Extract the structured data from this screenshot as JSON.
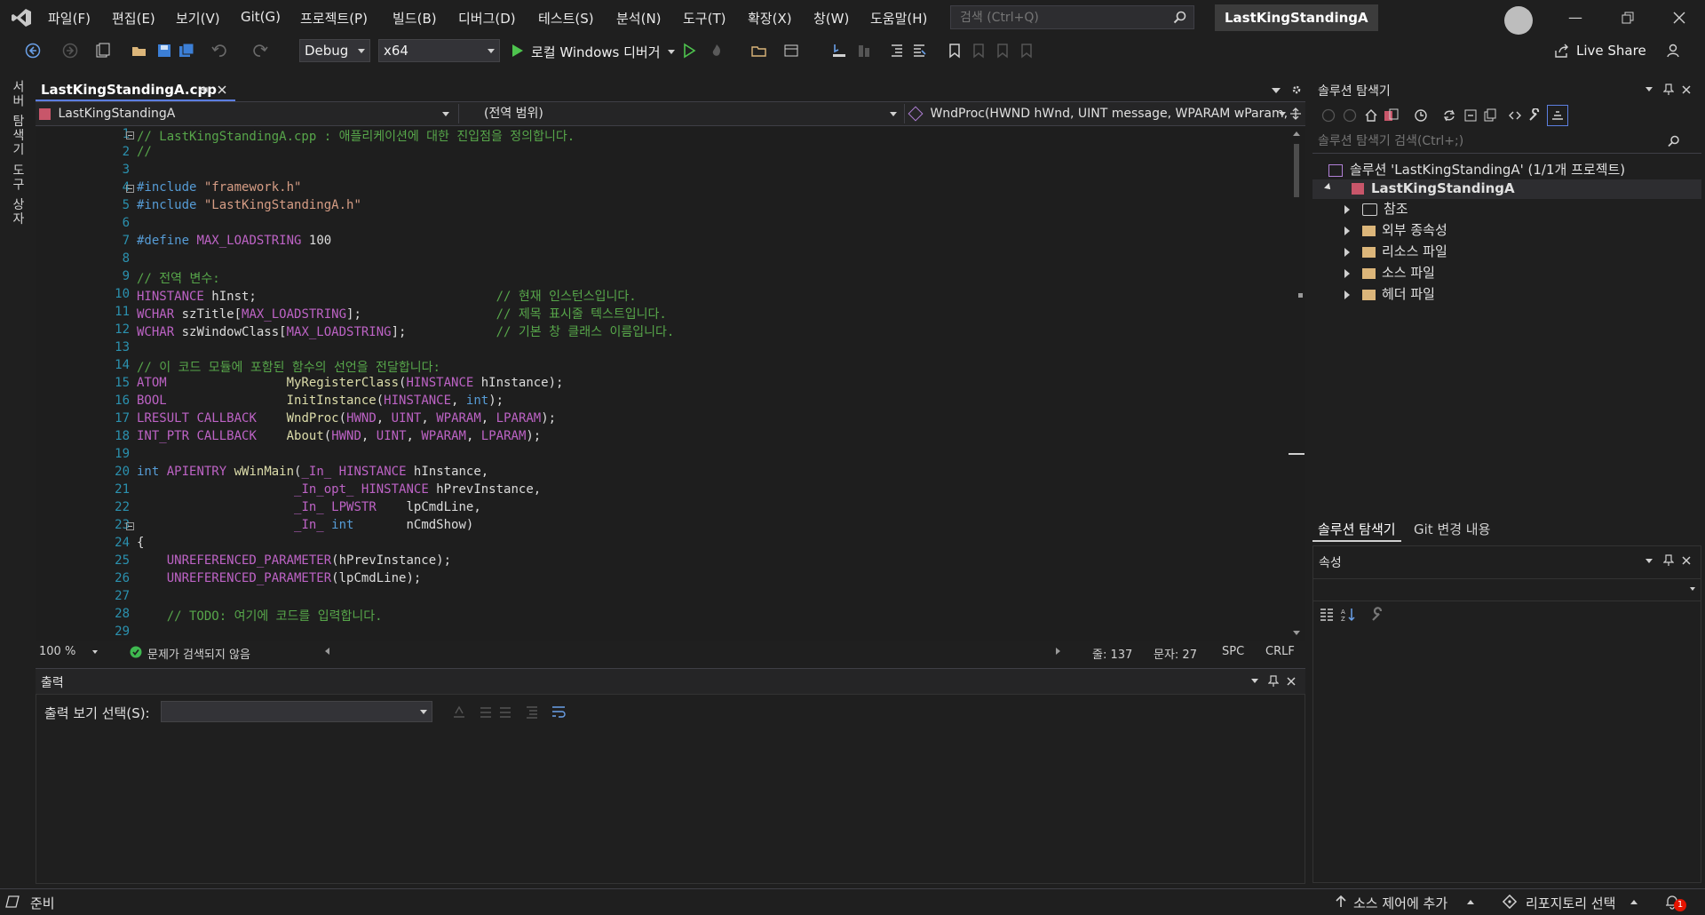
{
  "menu": {
    "items": [
      "파일(F)",
      "편집(E)",
      "보기(V)",
      "Git(G)",
      "프로젝트(P)",
      "빌드(B)",
      "디버그(D)",
      "테스트(S)",
      "분석(N)",
      "도구(T)",
      "확장(X)",
      "창(W)",
      "도움말(H)"
    ],
    "search_placeholder": "검색 (Ctrl+Q)",
    "project_title": "LastKingStandingA"
  },
  "toolbar": {
    "config": "Debug",
    "platform": "x64",
    "run_label": "로컬 Windows 디버거",
    "live_share": "Live Share"
  },
  "left_tabs": [
    "서버 탐색기",
    "도구 상자"
  ],
  "editor": {
    "tab_title": "LastKingStandingA.cpp",
    "nav_project": "LastKingStandingA",
    "nav_scope": "(전역 범위)",
    "nav_member": "WndProc(HWND hWnd, UINT message, WPARAM wParam, LP",
    "line_numbers": [
      "1",
      "2",
      "3",
      "4",
      "5",
      "6",
      "7",
      "8",
      "9",
      "10",
      "11",
      "12",
      "13",
      "14",
      "15",
      "16",
      "17",
      "18",
      "19",
      "20",
      "21",
      "22",
      "23",
      "24",
      "25",
      "26",
      "27",
      "28",
      "29"
    ],
    "lines": [
      {
        "t": "// LastKingStandingA.cpp : 애플리케이션에 대한 진입점을 정의합니다."
      },
      {
        "t": "//"
      },
      {
        "t": ""
      },
      {
        "t": "#include \"framework.h\""
      },
      {
        "t": "#include \"LastKingStandingA.h\""
      },
      {
        "t": ""
      },
      {
        "t": "#define MAX_LOADSTRING 100"
      },
      {
        "t": ""
      },
      {
        "t": "// 전역 변수:"
      },
      {
        "t": "HINSTANCE hInst;                                // 현재 인스턴스입니다."
      },
      {
        "t": "WCHAR szTitle[MAX_LOADSTRING];                  // 제목 표시줄 텍스트입니다."
      },
      {
        "t": "WCHAR szWindowClass[MAX_LOADSTRING];            // 기본 창 클래스 이름입니다."
      },
      {
        "t": ""
      },
      {
        "t": "// 이 코드 모듈에 포함된 함수의 선언을 전달합니다:"
      },
      {
        "t": "ATOM                MyRegisterClass(HINSTANCE hInstance);"
      },
      {
        "t": "BOOL                InitInstance(HINSTANCE, int);"
      },
      {
        "t": "LRESULT CALLBACK    WndProc(HWND, UINT, WPARAM, LPARAM);"
      },
      {
        "t": "INT_PTR CALLBACK    About(HWND, UINT, WPARAM, LPARAM);"
      },
      {
        "t": ""
      },
      {
        "t": "int APIENTRY wWinMain(_In_ HINSTANCE hInstance,"
      },
      {
        "t": "                     _In_opt_ HINSTANCE hPrevInstance,"
      },
      {
        "t": "                     _In_ LPWSTR    lpCmdLine,"
      },
      {
        "t": "                     _In_ int       nCmdShow)"
      },
      {
        "t": "{"
      },
      {
        "t": "    UNREFERENCED_PARAMETER(hPrevInstance);"
      },
      {
        "t": "    UNREFERENCED_PARAMETER(lpCmdLine);"
      },
      {
        "t": ""
      },
      {
        "t": "    // TODO: 여기에 코드를 입력합니다."
      },
      {
        "t": ""
      }
    ],
    "zoom": "100 %",
    "issues": "문제가 검색되지 않음",
    "line_label": "줄: 137",
    "char_label": "문자: 27",
    "spc": "SPC",
    "crlf": "CRLF"
  },
  "output": {
    "title": "출력",
    "source_label": "출력 보기 선택(S):",
    "source_value": ""
  },
  "solution": {
    "title": "솔루션 탐색기",
    "search_placeholder": "솔루션 탐색기 검색(Ctrl+;)",
    "root": "솔루션 'LastKingStandingA' (1/1개 프로젝트)",
    "project": "LastKingStandingA",
    "children": [
      "참조",
      "외부 종속성",
      "리소스 파일",
      "소스 파일",
      "헤더 파일"
    ],
    "tabs": [
      "솔루션 탐색기",
      "Git 변경 내용"
    ]
  },
  "properties": {
    "title": "속성"
  },
  "statusbar": {
    "ready": "준비",
    "source_control": "소스 제어에 추가",
    "repo": "리포지토리 선택",
    "notification_count": "1"
  },
  "colors": {
    "accent": "#5c7ee0",
    "comment": "#57a64a",
    "keyword": "#569cd6",
    "string": "#d69d85",
    "line_number": "#2b91af"
  }
}
